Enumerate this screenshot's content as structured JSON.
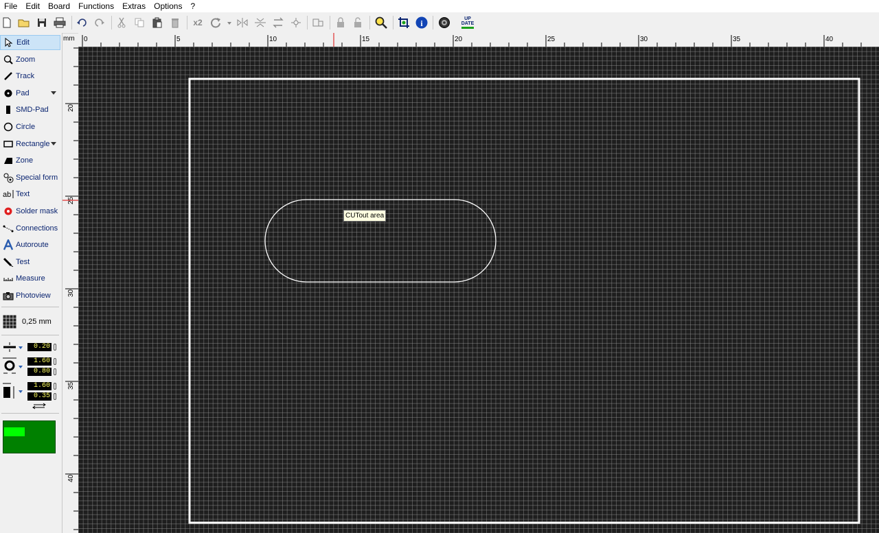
{
  "menu": [
    "File",
    "Edit",
    "Board",
    "Functions",
    "Extras",
    "Options",
    "?"
  ],
  "toolbar": {
    "x2_label": "x2",
    "update_label_top": "UP",
    "update_label_bottom": "DATE"
  },
  "tools": [
    {
      "id": "edit",
      "label": "Edit",
      "icon": "cursor-arrow-icon",
      "active": true
    },
    {
      "id": "zoom",
      "label": "Zoom",
      "icon": "magnifier-icon"
    },
    {
      "id": "track",
      "label": "Track",
      "icon": "track-line-icon"
    },
    {
      "id": "pad",
      "label": "Pad",
      "icon": "pad-circle-icon",
      "dropdown": true
    },
    {
      "id": "smd-pad",
      "label": "SMD-Pad",
      "icon": "smd-pad-icon"
    },
    {
      "id": "circle",
      "label": "Circle",
      "icon": "circle-icon"
    },
    {
      "id": "rectangle",
      "label": "Rectangle",
      "icon": "rectangle-icon",
      "dropdown": true
    },
    {
      "id": "zone",
      "label": "Zone",
      "icon": "zone-icon"
    },
    {
      "id": "special-form",
      "label": "Special form",
      "icon": "special-form-icon"
    },
    {
      "id": "text",
      "label": "Text",
      "icon": "text-ab-icon"
    },
    {
      "id": "solder-mask",
      "label": "Solder mask",
      "icon": "solder-mask-icon"
    },
    {
      "id": "connections",
      "label": "Connections",
      "icon": "connections-icon"
    },
    {
      "id": "autoroute",
      "label": "Autoroute",
      "icon": "autoroute-icon"
    },
    {
      "id": "test",
      "label": "Test",
      "icon": "test-probe-icon"
    },
    {
      "id": "measure",
      "label": "Measure",
      "icon": "ruler-icon"
    },
    {
      "id": "photoview",
      "label": "Photoview",
      "icon": "camera-icon"
    }
  ],
  "grid": {
    "label": "0,25 mm"
  },
  "params": {
    "track_width": "0.20",
    "pad_outer": "1.60",
    "pad_inner": "0.80",
    "smd_width": "1.60",
    "smd_height": "0.35"
  },
  "ruler": {
    "unit": "mm",
    "h_labels": [
      "0",
      "5",
      "10",
      "15",
      "20",
      "25",
      "30",
      "35",
      "40"
    ],
    "v_labels": [
      "20",
      "25",
      "30",
      "35",
      "40"
    ]
  },
  "canvas": {
    "tooltip": "CUTout area",
    "colors": {
      "background": "#1e1e1e",
      "grid": "#6a6a6a",
      "outline": "#ffffff"
    }
  },
  "layer_preview": {
    "colors": {
      "board": "#008000",
      "highlight": "#00ff00"
    }
  }
}
